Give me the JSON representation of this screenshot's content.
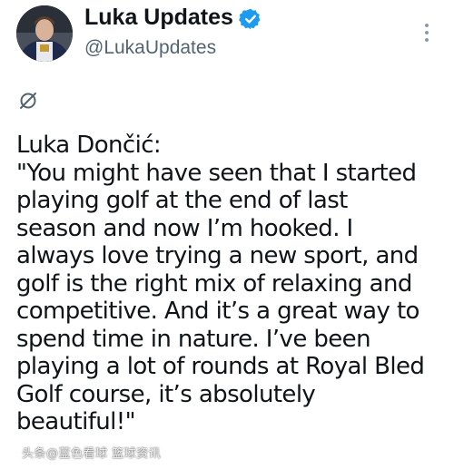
{
  "author": {
    "display_name": "Luka Updates",
    "handle": "@LukaUpdates",
    "verified": true,
    "verified_color": "#1d9bf0"
  },
  "icons": {
    "avatar": "player-avatar",
    "verified": "verified-badge-icon",
    "more": "more-options-icon",
    "reply_context": "empty-set-icon"
  },
  "tweet": {
    "lines": [
      "Luka Dončić:",
      "\"You might have seen that I started",
      "playing golf at the end of last",
      "season and now I’m hooked. I",
      "always love trying a new sport, and",
      "golf is the right mix of relaxing and",
      "competitive. And it’s a great way to",
      "spend time in nature. I’ve been",
      "playing a lot of rounds at Royal Bled",
      "Golf course, it’s absolutely",
      "beautiful!\""
    ]
  },
  "watermark": {
    "text": "头条@蓝色看球 篮球资讯"
  }
}
